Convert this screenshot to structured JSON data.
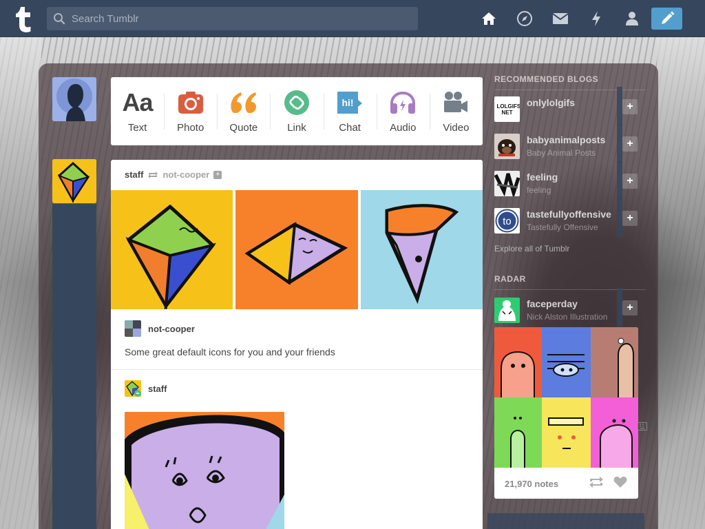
{
  "app": {
    "name": "Tumblr"
  },
  "header": {
    "search_placeholder": "Search Tumblr",
    "nav": [
      "home-icon",
      "explore-icon",
      "inbox-icon",
      "activity-icon",
      "account-icon"
    ],
    "compose": "compose-icon"
  },
  "post_types": [
    {
      "label": "Text",
      "icon": "text-icon",
      "color": "#444444"
    },
    {
      "label": "Photo",
      "icon": "camera-icon",
      "color": "#d95e40"
    },
    {
      "label": "Quote",
      "icon": "quote-icon",
      "color": "#f2992e"
    },
    {
      "label": "Link",
      "icon": "link-icon",
      "color": "#56bc8a"
    },
    {
      "label": "Chat",
      "icon": "chat-icon",
      "color": "#529ecc"
    },
    {
      "label": "Audio",
      "icon": "headphones-icon",
      "color": "#a77dc2"
    },
    {
      "label": "Video",
      "icon": "video-camera-icon",
      "color": "#748089"
    }
  ],
  "post": {
    "author": "staff",
    "reblogged_from": "not-cooper",
    "trail": [
      {
        "name": "not-cooper",
        "text": "Some great default icons for you and your friends"
      },
      {
        "name": "staff"
      }
    ]
  },
  "sidebar": {
    "recommended_heading": "RECOMMENDED BLOGS",
    "blogs": [
      {
        "name": "onlylolgifs",
        "subtitle": "",
        "avatar_text": "LOLGIFS. NET"
      },
      {
        "name": "babyanimalposts",
        "subtitle": "Baby Animal Posts"
      },
      {
        "name": "feeling",
        "subtitle": "feeling"
      },
      {
        "name": "tastefullyoffensive",
        "subtitle": "Tastefully Offensive",
        "avatar_text": "to"
      }
    ],
    "explore": "Explore all of Tumblr",
    "radar_heading": "RADAR",
    "radar": {
      "name": "faceperday",
      "subtitle": "Nick Alston Illustration",
      "notes": "21,970 notes"
    }
  },
  "colors": {
    "topbar": "#36465d",
    "accent": "#529ecc"
  }
}
